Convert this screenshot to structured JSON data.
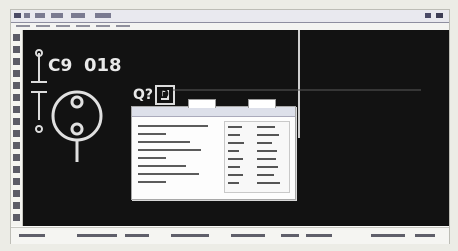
{
  "window": {
    "title_bar": "",
    "menu_items_visible": 6
  },
  "toolbar": {
    "left_tools": [
      "select-icon",
      "zoom-icon",
      "pan-icon",
      "wire-icon",
      "bus-icon",
      "junction-icon",
      "label-icon",
      "component-icon",
      "power-icon",
      "ground-icon",
      "text-icon",
      "arc-icon",
      "circle-icon",
      "line-icon",
      "rect-icon",
      "measure-icon"
    ]
  },
  "canvas": {
    "component_ref": "C9",
    "component_value": "018",
    "side_label": "Q?",
    "connector_label": "D"
  },
  "dialog": {
    "title": ""
  },
  "status": {
    "text": ""
  },
  "colors": {
    "canvas_bg": "#121212",
    "schematic_stroke": "#dcdcdc",
    "window_bg": "#fafaf8"
  }
}
